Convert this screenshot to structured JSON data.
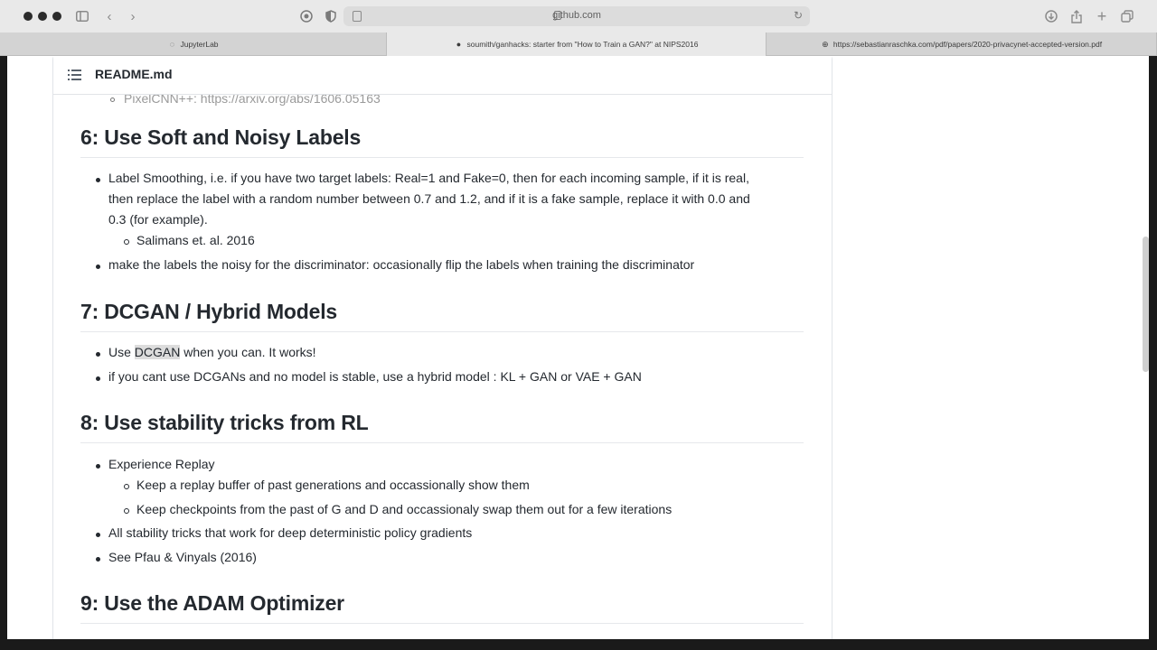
{
  "browser": {
    "url": "github.com",
    "tabs": [
      {
        "label": "JupyterLab"
      },
      {
        "label": "soumith/ganhacks: starter from \"How to Train a GAN?\" at NIPS2016"
      },
      {
        "label": "https://sebastianraschka.com/pdf/papers/2020-privacynet-accepted-version.pdf"
      }
    ]
  },
  "readme": {
    "filename": "README.md",
    "cut_off_line": "PixelCNN++: https://arxiv.org/abs/1606.05163",
    "section6": {
      "title": "6: Use Soft and Noisy Labels",
      "b1_l1": "Label Smoothing, i.e. if you have two target labels: Real=1 and Fake=0, then for each incoming sample, if it is real,",
      "b1_l2": "then replace the label with a random number between 0.7 and 1.2, and if it is a fake sample, replace it with 0.0 and",
      "b1_l3": "0.3 (for example).",
      "b1_sub": "Salimans et. al. 2016",
      "b2": "make the labels the noisy for the discriminator: occasionally flip the labels when training the discriminator"
    },
    "section7": {
      "title": "7: DCGAN / Hybrid Models",
      "b1_pre": "Use ",
      "b1_hl": "DCGAN",
      "b1_post": " when you can. It works!",
      "b2": "if you cant use DCGANs and no model is stable, use a hybrid model : KL + GAN or VAE + GAN"
    },
    "section8": {
      "title": "8: Use stability tricks from RL",
      "b1": "Experience Replay",
      "b1_sub1": "Keep a replay buffer of past generations and occassionally show them",
      "b1_sub2": "Keep checkpoints from the past of G and D and occassionaly swap them out for a few iterations",
      "b2": "All stability tricks that work for deep deterministic policy gradients",
      "b3": "See Pfau & Vinyals (2016)"
    },
    "section9": {
      "title": "9: Use the ADAM Optimizer"
    }
  }
}
